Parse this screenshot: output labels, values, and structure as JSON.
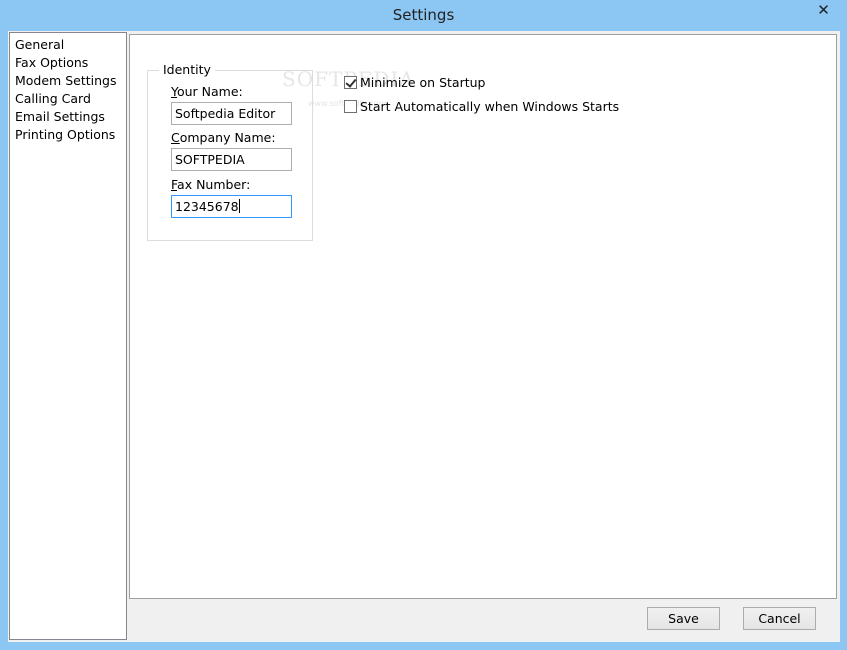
{
  "window": {
    "title": "Settings",
    "close_glyph": "✕"
  },
  "sidebar": {
    "items": [
      {
        "label": "General"
      },
      {
        "label": "Fax Options"
      },
      {
        "label": "Modem Settings"
      },
      {
        "label": "Calling Card"
      },
      {
        "label": "Email Settings"
      },
      {
        "label": "Printing Options"
      }
    ]
  },
  "identity": {
    "group_title": "Identity",
    "your_name": {
      "label_hotkey": "Y",
      "label_rest": "our Name:",
      "value": "Softpedia Editor"
    },
    "company_name": {
      "label_hotkey": "C",
      "label_rest": "ompany Name:",
      "value": "SOFTPEDIA"
    },
    "fax_number": {
      "label_hotkey": "F",
      "label_rest": "ax Number:",
      "value": "12345678"
    }
  },
  "options": {
    "minimize_on_startup": {
      "label": "Minimize on Startup",
      "checked": true
    },
    "start_automatically": {
      "label": "Start Automatically when Windows Starts",
      "checked": false
    }
  },
  "watermark": {
    "text": "SOFTPEDIA",
    "small": "www.softpedia.com"
  },
  "buttons": {
    "save": "Save",
    "cancel": "Cancel"
  }
}
